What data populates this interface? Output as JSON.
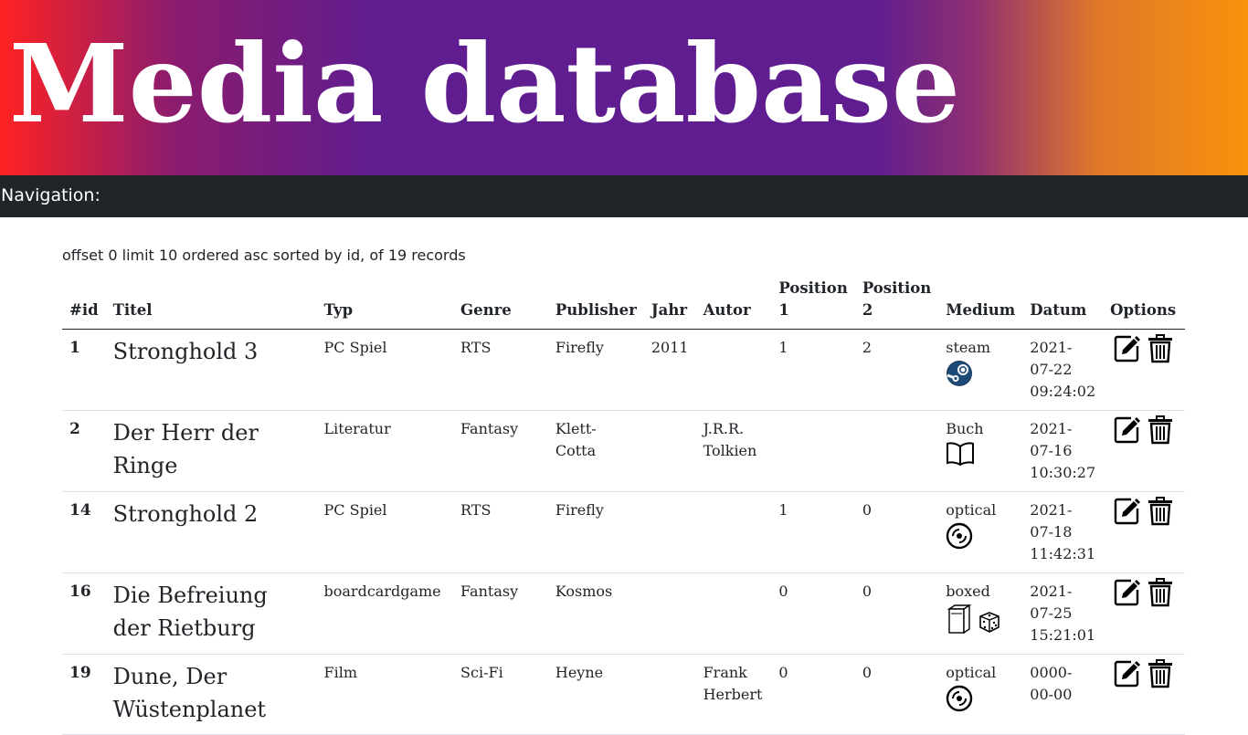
{
  "banner": {
    "title": "Media database"
  },
  "nav": {
    "label": "Navigation:"
  },
  "meta": {
    "text": "offset 0 limit 10 ordered asc sorted by id, of 19 records"
  },
  "table": {
    "headers": [
      "#id",
      "Titel",
      "Typ",
      "Genre",
      "Publisher",
      "Jahr",
      "Autor",
      "Position 1",
      "Position 2",
      "Medium",
      "Datum",
      "Options"
    ],
    "rows": [
      {
        "id": "1",
        "title": "Stronghold 3",
        "typ": "PC Spiel",
        "genre": "RTS",
        "publisher": "Firefly",
        "jahr": "2011",
        "autor": "",
        "pos1": "1",
        "pos2": "2",
        "medium": "steam",
        "medium_icon": "steam-icon",
        "datum": "2021-07-22 09:24:02"
      },
      {
        "id": "2",
        "title": "Der Herr der Ringe",
        "typ": "Literatur",
        "genre": "Fantasy",
        "publisher": "Klett-Cotta",
        "jahr": "",
        "autor": "J.R.R. Tolkien",
        "pos1": "",
        "pos2": "",
        "medium": "Buch",
        "medium_icon": "book-icon",
        "datum": "2021-07-16 10:30:27"
      },
      {
        "id": "14",
        "title": "Stronghold 2",
        "typ": "PC Spiel",
        "genre": "RTS",
        "publisher": "Firefly",
        "jahr": "",
        "autor": "",
        "pos1": "1",
        "pos2": "0",
        "medium": "optical",
        "medium_icon": "disc-icon",
        "datum": "2021-07-18 11:42:31"
      },
      {
        "id": "16",
        "title": "Die Befreiung der Rietburg",
        "typ": "boardcardgame",
        "genre": "Fantasy",
        "publisher": "Kosmos",
        "jahr": "",
        "autor": "",
        "pos1": "0",
        "pos2": "0",
        "medium": "boxed",
        "medium_icon": "box-dice-icon",
        "datum": "2021-07-25 15:21:01"
      },
      {
        "id": "19",
        "title": "Dune, Der Wüstenplanet",
        "typ": "Film",
        "genre": "Sci-Fi",
        "publisher": "Heyne",
        "jahr": "",
        "autor": "Frank Herbert",
        "pos1": "0",
        "pos2": "0",
        "medium": "optical",
        "medium_icon": "disc-icon",
        "datum": "0000-00-00"
      }
    ]
  },
  "options": {
    "edit_icon": "edit-icon",
    "delete_icon": "trash-icon"
  }
}
